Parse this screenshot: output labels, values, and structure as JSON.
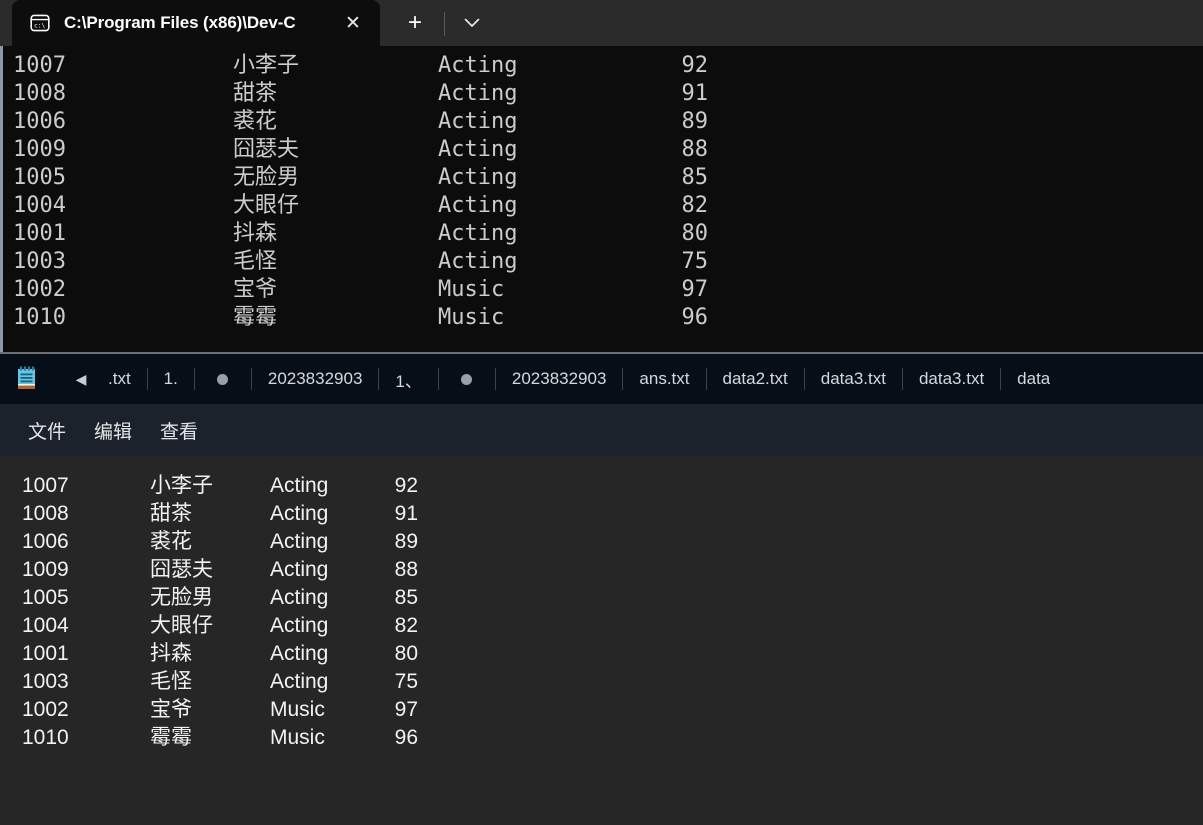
{
  "terminal": {
    "tab": {
      "icon": "console-icon",
      "title": "C:\\Program Files (x86)\\Dev-C",
      "close_label": "✕"
    },
    "new_tab_label": "+",
    "dropdown_label": "⌄",
    "text_color": "#cccccc",
    "bg_color": "#0c0c0c",
    "rows": [
      {
        "id": "1007",
        "name": "小李子",
        "dept": "Acting",
        "score": "92"
      },
      {
        "id": "1008",
        "name": "甜茶",
        "dept": "Acting",
        "score": "91"
      },
      {
        "id": "1006",
        "name": "裘花",
        "dept": "Acting",
        "score": "89"
      },
      {
        "id": "1009",
        "name": "囧瑟夫",
        "dept": "Acting",
        "score": "88"
      },
      {
        "id": "1005",
        "name": "无脸男",
        "dept": "Acting",
        "score": "85"
      },
      {
        "id": "1004",
        "name": "大眼仔",
        "dept": "Acting",
        "score": "82"
      },
      {
        "id": "1001",
        "name": "抖森",
        "dept": "Acting",
        "score": "80"
      },
      {
        "id": "1003",
        "name": "毛怪",
        "dept": "Acting",
        "score": "75"
      },
      {
        "id": "1002",
        "name": "宝爷",
        "dept": "Music",
        "score": "97"
      },
      {
        "id": "1010",
        "name": "霉霉",
        "dept": "Music",
        "score": "96"
      }
    ]
  },
  "notepad": {
    "app_icon": "notepad-icon",
    "scroll_left_label": "◀",
    "tabbar_bg": "#060f17",
    "menubar_bg": "#1c222b",
    "content_bg": "#262626",
    "tabs": [
      {
        "label": ".txt"
      },
      {
        "label": "1."
      },
      {
        "label": "●",
        "type": "dot"
      },
      {
        "label": "2023832903"
      },
      {
        "label": "1、"
      },
      {
        "label": "●",
        "type": "dot"
      },
      {
        "label": "2023832903"
      },
      {
        "label": "ans.txt"
      },
      {
        "label": "data2.txt"
      },
      {
        "label": "data3.txt"
      },
      {
        "label": "data3.txt"
      },
      {
        "label": "data"
      }
    ],
    "menu": [
      {
        "label": "文件"
      },
      {
        "label": "编辑"
      },
      {
        "label": "查看"
      }
    ],
    "rows": [
      {
        "id": "1007",
        "name": "小李子",
        "dept": "Acting",
        "score": "92"
      },
      {
        "id": "1008",
        "name": "甜茶",
        "dept": "Acting",
        "score": "91"
      },
      {
        "id": "1006",
        "name": "裘花",
        "dept": "Acting",
        "score": "89"
      },
      {
        "id": "1009",
        "name": "囧瑟夫",
        "dept": "Acting",
        "score": "88"
      },
      {
        "id": "1005",
        "name": "无脸男",
        "dept": "Acting",
        "score": "85"
      },
      {
        "id": "1004",
        "name": "大眼仔",
        "dept": "Acting",
        "score": "82"
      },
      {
        "id": "1001",
        "name": "抖森",
        "dept": "Acting",
        "score": "80"
      },
      {
        "id": "1003",
        "name": "毛怪",
        "dept": "Acting",
        "score": "75"
      },
      {
        "id": "1002",
        "name": "宝爷",
        "dept": "Music",
        "score": "97"
      },
      {
        "id": "1010",
        "name": "霉霉",
        "dept": "Music",
        "score": "96"
      }
    ]
  }
}
